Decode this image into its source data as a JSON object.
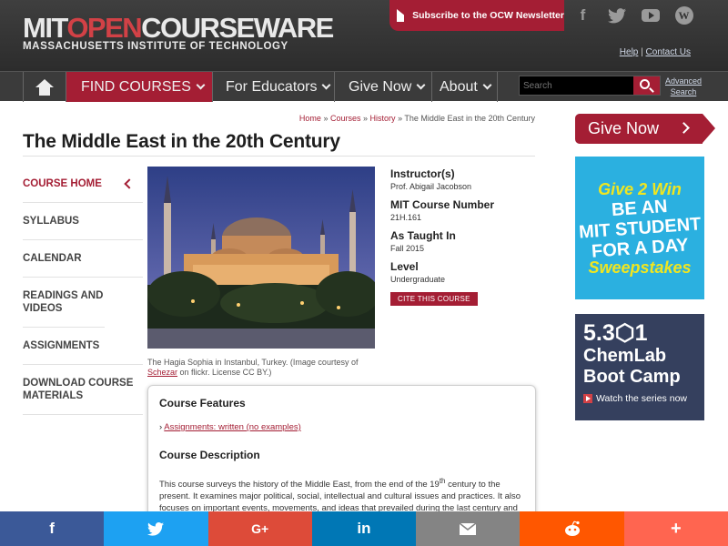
{
  "header": {
    "logo_part1": "MIT",
    "logo_part2": "OPEN",
    "logo_part3": "COURSEWARE",
    "logo_sub": "MASSACHUSETTS INSTITUTE OF TECHNOLOGY",
    "newsletter_label": "Subscribe to the OCW Newsletter",
    "social": [
      "facebook-icon",
      "twitter-icon",
      "youtube-icon",
      "wordpress-icon"
    ],
    "help": "Help",
    "separator": "|",
    "contact": "Contact Us"
  },
  "nav": {
    "find_courses": "FIND COURSES",
    "for_educators": "For Educators",
    "give_now": "Give Now",
    "about": "About",
    "search_placeholder": "Search",
    "advanced_search_1": "Advanced",
    "advanced_search_2": "Search"
  },
  "breadcrumb": {
    "home": "Home",
    "courses": "Courses",
    "history": "History",
    "sep": "»",
    "current": "The Middle East in the 20th Century"
  },
  "page_title": "The Middle East in the 20th Century",
  "leftnav": [
    "COURSE HOME",
    "SYLLABUS",
    "CALENDAR",
    "READINGS AND VIDEOS",
    "ASSIGNMENTS",
    "DOWNLOAD COURSE MATERIALS"
  ],
  "image_caption": {
    "text1": "The Hagia Sophia in Instanbul, Turkey. (Image courtesy of",
    "link": "Schezar",
    "text2": "on flickr. License CC BY.)"
  },
  "info": {
    "instructor_h": "Instructor(s)",
    "instructor_v": "Prof. Abigail Jacobson",
    "number_h": "MIT Course Number",
    "number_v": "21H.161",
    "taught_h": "As Taught In",
    "taught_v": "Fall 2015",
    "level_h": "Level",
    "level_v": "Undergraduate",
    "cite": "CITE THIS COURSE"
  },
  "features": {
    "features_h": "Course Features",
    "feature_item": "Assignments: written (no examples)",
    "description_h": "Course Description",
    "description_1": "This course surveys the history of the Middle East, from the end of the 19",
    "description_sup": "th",
    "description_2": " century to the present. It examines major political, social, intellectual and cultural issues and practices. It also focuses on important events, movements, and ideas that prevailed during the last century and"
  },
  "right": {
    "give_now": "Give Now",
    "promo1_a": "Give 2 Win",
    "promo1_b1": "BE AN",
    "promo1_b2": "MIT STUDENT",
    "promo1_b3": "FOR A DAY",
    "promo1_c": "Sweepstakes",
    "promo2_n": "5.3⬡1",
    "promo2_t1": "ChemLab",
    "promo2_t2": "Boot Camp",
    "promo2_w": "Watch the series now"
  },
  "sharebar": [
    {
      "name": "facebook",
      "glyph": "f",
      "color": "#3b5998"
    },
    {
      "name": "twitter",
      "glyph": "🐦",
      "color": "#1da1f2"
    },
    {
      "name": "google-plus",
      "glyph": "G+",
      "color": "#dd4b39"
    },
    {
      "name": "linkedin",
      "glyph": "in",
      "color": "#0077b5"
    },
    {
      "name": "email",
      "glyph": "✉",
      "color": "#848484"
    },
    {
      "name": "reddit",
      "glyph": "👽",
      "color": "#ff5700"
    },
    {
      "name": "more",
      "glyph": "+",
      "color": "#ff6550"
    }
  ],
  "colors": {
    "brand_red": "#a41e34",
    "header_bg": "#333333"
  }
}
